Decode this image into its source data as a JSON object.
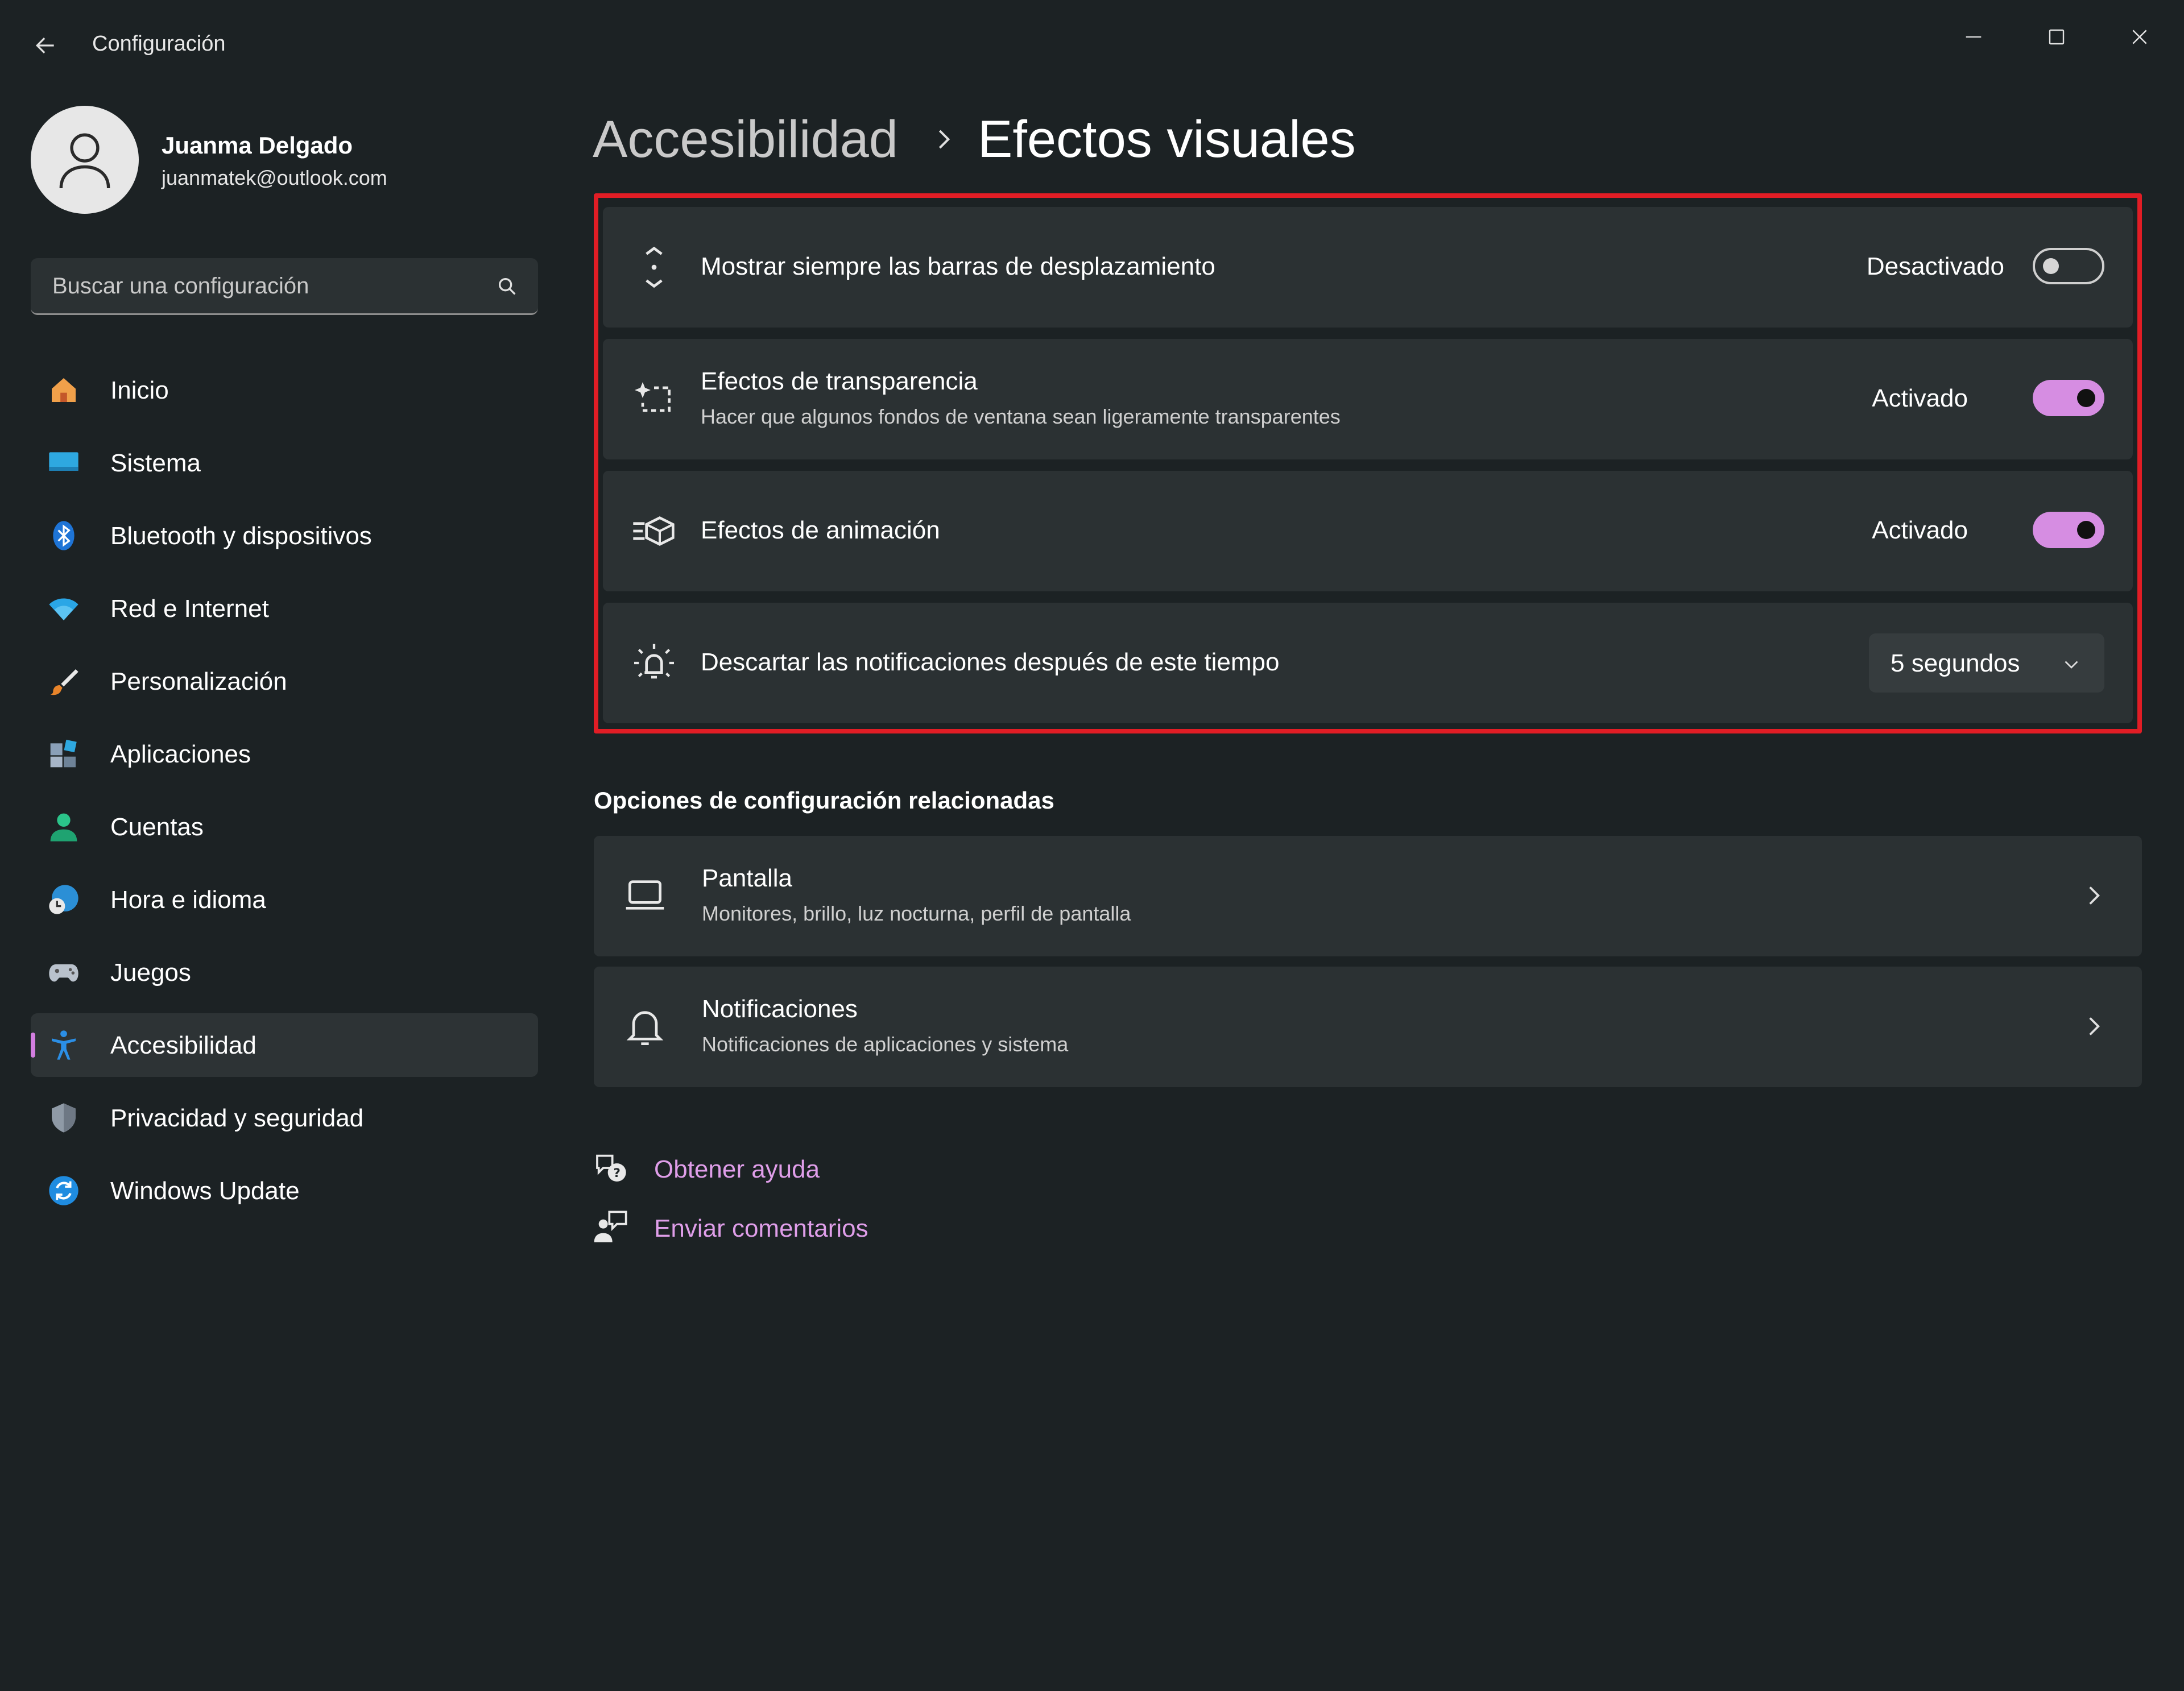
{
  "window": {
    "title": "Configuración"
  },
  "user": {
    "name": "Juanma Delgado",
    "email": "juanmatek@outlook.com"
  },
  "search": {
    "placeholder": "Buscar una configuración"
  },
  "sidebar": {
    "items": [
      {
        "label": "Inicio",
        "icon": "home-icon"
      },
      {
        "label": "Sistema",
        "icon": "monitor-icon"
      },
      {
        "label": "Bluetooth y dispositivos",
        "icon": "bluetooth-icon"
      },
      {
        "label": "Red e Internet",
        "icon": "wifi-icon"
      },
      {
        "label": "Personalización",
        "icon": "brush-icon"
      },
      {
        "label": "Aplicaciones",
        "icon": "apps-icon"
      },
      {
        "label": "Cuentas",
        "icon": "person-icon"
      },
      {
        "label": "Hora e idioma",
        "icon": "globe-clock-icon"
      },
      {
        "label": "Juegos",
        "icon": "gamepad-icon"
      },
      {
        "label": "Accesibilidad",
        "icon": "accessibility-icon",
        "active": true
      },
      {
        "label": "Privacidad y seguridad",
        "icon": "shield-icon"
      },
      {
        "label": "Windows Update",
        "icon": "update-icon"
      }
    ],
    "accent": "#d37ee0"
  },
  "breadcrumb": {
    "parent": "Accesibilidad",
    "current": "Efectos visuales"
  },
  "settings": {
    "scrollbars": {
      "title": "Mostrar siempre las barras de desplazamiento",
      "state": "Desactivado",
      "on": false
    },
    "transparency": {
      "title": "Efectos de transparencia",
      "subtitle": "Hacer que algunos fondos de ventana sean ligeramente transparentes",
      "state": "Activado",
      "on": true
    },
    "animation": {
      "title": "Efectos de animación",
      "state": "Activado",
      "on": true
    },
    "notifications": {
      "title": "Descartar las notificaciones después de este tiempo",
      "value": "5 segundos"
    }
  },
  "related": {
    "title": "Opciones de configuración relacionadas",
    "items": [
      {
        "title": "Pantalla",
        "subtitle": "Monitores, brillo, luz nocturna, perfil de pantalla",
        "icon": "laptop-icon"
      },
      {
        "title": "Notificaciones",
        "subtitle": "Notificaciones de aplicaciones y sistema",
        "icon": "bell-icon"
      }
    ]
  },
  "help": {
    "get_help": "Obtener ayuda",
    "feedback": "Enviar comentarios"
  },
  "colors": {
    "toggle_on": "#d68de2",
    "highlight_border": "#e11d25",
    "link": "#df9ee9"
  }
}
